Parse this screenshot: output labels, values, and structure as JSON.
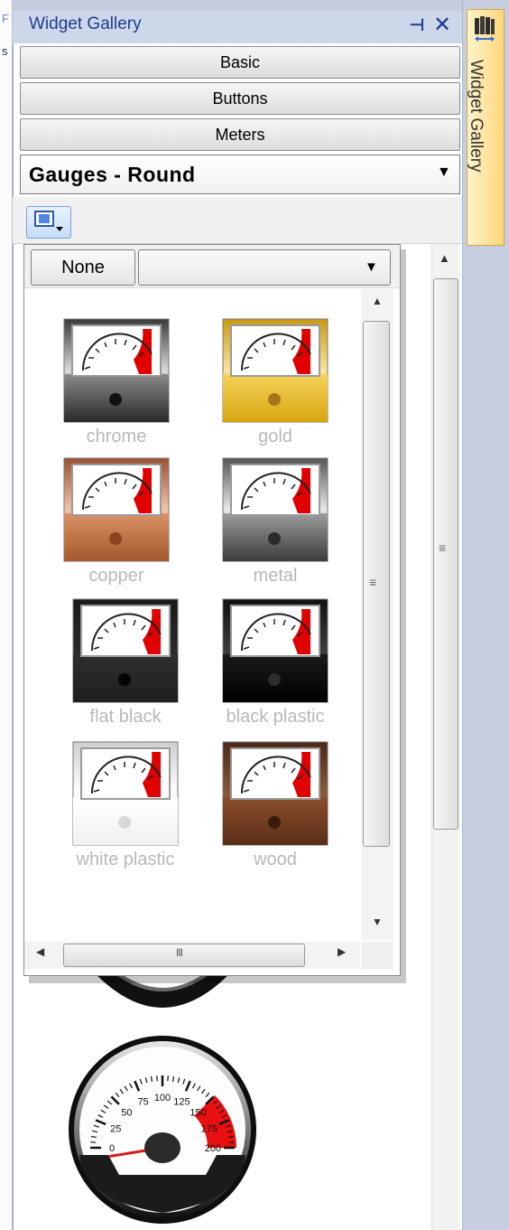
{
  "panel": {
    "title": "Widget Gallery",
    "pin_icon": "pin-icon",
    "close_icon": "close-icon"
  },
  "accordion": {
    "items": [
      {
        "label": "Basic"
      },
      {
        "label": "Buttons"
      },
      {
        "label": "Meters"
      }
    ]
  },
  "category_dropdown": {
    "selected": "Gauges - Round"
  },
  "toolbar": {
    "view_button_icon": "style-picker-icon"
  },
  "style_popup": {
    "none_label": "None",
    "filter_selected": "",
    "hscroll_grip": "III",
    "styles": [
      {
        "label": "chrome",
        "frame": "#3a3a3a",
        "frame_light": "#d9d9d9",
        "base": "#2a2a2a",
        "base_light": "#8a8a8a",
        "knob": "#111111"
      },
      {
        "label": "gold",
        "frame": "#c99a12",
        "frame_light": "#f8e4a0",
        "base": "#d7a510",
        "base_light": "#f5d35a",
        "knob": "#a8761a"
      },
      {
        "label": "copper",
        "frame": "#9a5030",
        "frame_light": "#f1c4ac",
        "base": "#a5582e",
        "base_light": "#d99266",
        "knob": "#8c4420"
      },
      {
        "label": "metal",
        "frame": "#555555",
        "frame_light": "#e9e9e9",
        "base": "#3c3c3c",
        "base_light": "#9c9c9c",
        "knob": "#2a2a2a"
      },
      {
        "label": "flat black",
        "frame": "#1a1a1a",
        "frame_light": "#2a2a2a",
        "base": "#1f1f1f",
        "base_light": "#2e2e2e",
        "knob": "#050505"
      },
      {
        "label": "black plastic",
        "frame": "#111111",
        "frame_light": "#3c3c3c",
        "base": "#000000",
        "base_light": "#1a1a1a",
        "knob": "#2c2c2c"
      },
      {
        "label": "white plastic",
        "frame": "#cfcfcf",
        "frame_light": "#ffffff",
        "base": "#f0f0f0",
        "base_light": "#ffffff",
        "knob": "#d6d6d6"
      },
      {
        "label": "wood",
        "frame": "#4a2818",
        "frame_light": "#8a5a3a",
        "base": "#5a2e18",
        "base_light": "#8a4e2a",
        "knob": "#3a1c0c"
      }
    ]
  },
  "preview_gauge": {
    "scale_labels": [
      "0",
      "25",
      "50",
      "75",
      "100",
      "125",
      "150",
      "175",
      "200"
    ],
    "needle_value": 0,
    "redline_from": 150
  },
  "side_tab": {
    "label": "Widget Gallery",
    "icon": "gallery-icon"
  }
}
